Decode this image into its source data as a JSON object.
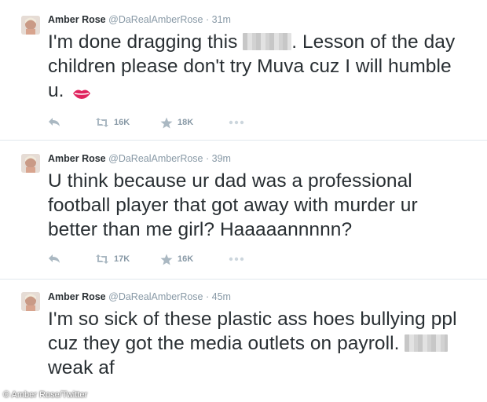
{
  "tweets": [
    {
      "name": "Amber Rose",
      "handle": "@DaRealAmberRose",
      "separator": "·",
      "time": "31m",
      "text_before": "I'm done dragging this",
      "text_after": ". Lesson of the day children please don't try Muva cuz I will humble u.",
      "emoji": "kiss-lips-icon",
      "retweets": "16K",
      "favorites": "18K"
    },
    {
      "name": "Amber Rose",
      "handle": "@DaRealAmberRose",
      "separator": "·",
      "time": "39m",
      "text": "U think because ur dad was a professional football player that got away with murder ur better than me girl? Haaaaannnnn?",
      "retweets": "17K",
      "favorites": "16K"
    },
    {
      "name": "Amber Rose",
      "handle": "@DaRealAmberRose",
      "separator": "·",
      "time": "45m",
      "text_line1": "I'm so sick of these plastic ass hoes bullying ppl cuz they got the media outlets on payroll.",
      "text_after": "weak af"
    }
  ],
  "credit": "© Amber Rose/Twitter",
  "colors": {
    "text": "#292f33",
    "muted": "#8899a6",
    "divider": "#e1e8ed",
    "lips": "#e0245e"
  }
}
